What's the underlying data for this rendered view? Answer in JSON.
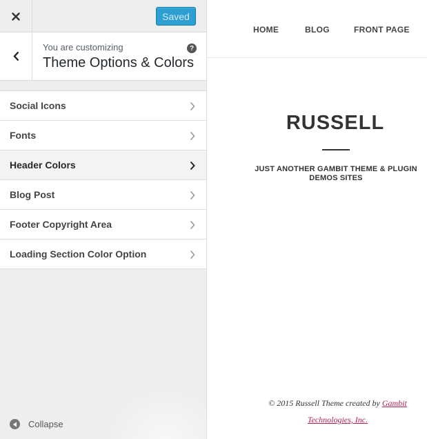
{
  "topbar": {
    "close_icon": "close-x-icon",
    "saved_label": "Saved",
    "saved_color": "#2e9fd2"
  },
  "info": {
    "back_icon": "chevron-left-icon",
    "customizing_label": "You are customizing",
    "section_title": "Theme Options & Colors",
    "help_icon": "question-mark-icon",
    "help_glyph": "?"
  },
  "menu": {
    "items": [
      {
        "label": "Social Icons",
        "active": false
      },
      {
        "label": "Fonts",
        "active": false
      },
      {
        "label": "Header Colors",
        "active": true
      },
      {
        "label": "Blog Post",
        "active": false
      },
      {
        "label": "Footer Copyright Area",
        "active": false
      },
      {
        "label": "Loading Section Color Option",
        "active": false
      }
    ],
    "item_icon": "chevron-right-icon"
  },
  "collapse": {
    "label": "Collapse",
    "icon": "collapse-arrow-icon"
  },
  "preview": {
    "nav": [
      "HOME",
      "BLOG",
      "FRONT PAGE"
    ],
    "site_title": "RUSSELL",
    "tagline": "JUST ANOTHER GAMBIT THEME & PLUGIN DEMOS SITES",
    "footer_text": "© 2015 Russell Theme created by ",
    "footer_link": "Gambit Technologies, Inc.",
    "link_color": "#b01e55"
  }
}
